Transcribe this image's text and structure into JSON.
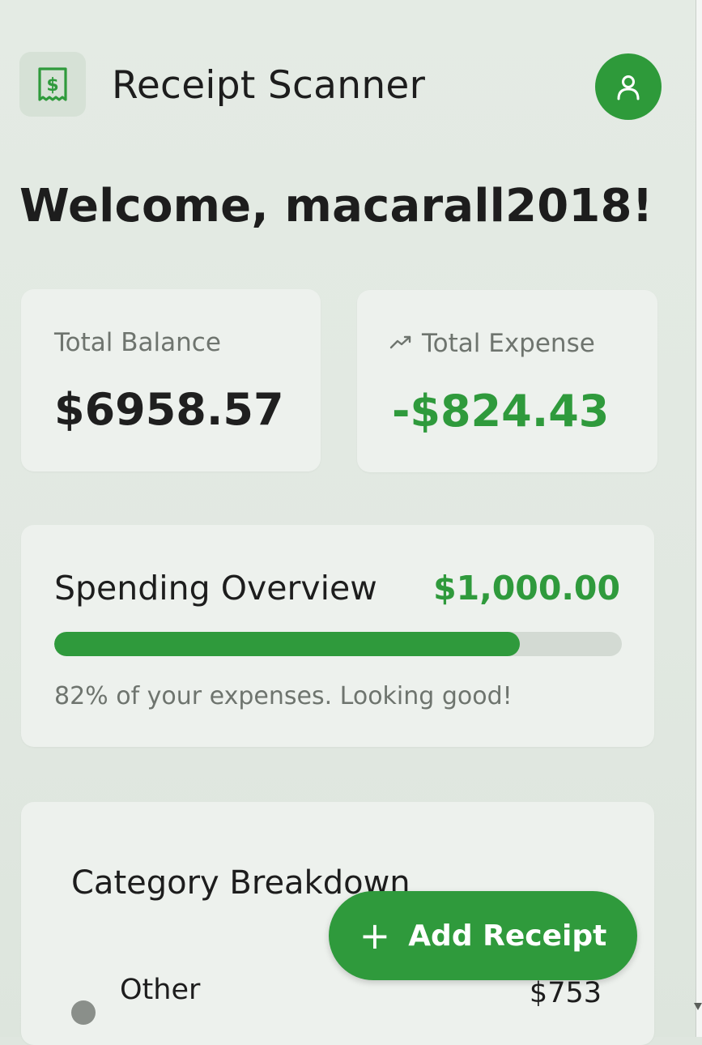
{
  "header": {
    "app_title": "Receipt Scanner",
    "logo_icon": "receipt-dollar-icon",
    "profile_icon": "user-icon"
  },
  "welcome": {
    "text": "Welcome, macarall2018!"
  },
  "stats": {
    "balance_label": "Total Balance",
    "balance_value": "$6958.57",
    "expense_label": "Total Expense",
    "expense_icon": "trending-icon",
    "expense_value": "-$824.43"
  },
  "spending": {
    "title": "Spending Overview",
    "amount": "$1,000.00",
    "progress_percent": 82,
    "note": "82% of your expenses. Looking good!"
  },
  "category": {
    "title": "Category Breakdown",
    "items": [
      {
        "name": "Other",
        "amount": "$753",
        "color": "#8a8f8a"
      }
    ]
  },
  "fab": {
    "icon": "plus-icon",
    "plus_glyph": "+",
    "label": "Add Receipt"
  },
  "colors": {
    "accent": "#2f9a3c",
    "card": "#edf1ed",
    "background": "#e1e8e1"
  }
}
